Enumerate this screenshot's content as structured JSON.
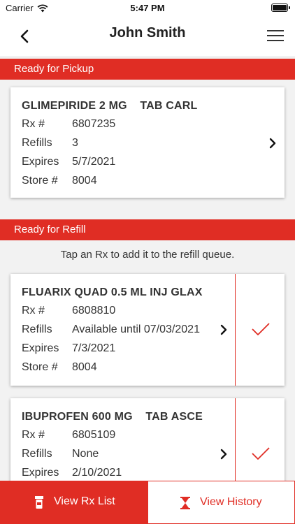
{
  "status_bar": {
    "carrier": "Carrier",
    "time": "5:47 PM"
  },
  "nav": {
    "title": "John Smith",
    "back_icon": "chevron-left-icon",
    "menu_icon": "hamburger-menu-icon"
  },
  "pickup": {
    "header": "Ready for Pickup",
    "card": {
      "drug": "GLIMEPIRIDE 2 MG    TAB CARL",
      "rows": [
        {
          "label": "Rx #",
          "value": "6807235"
        },
        {
          "label": "Refills",
          "value": "3"
        },
        {
          "label": "Expires",
          "value": "5/7/2021"
        },
        {
          "label": "Store #",
          "value": "8004"
        }
      ]
    }
  },
  "refill": {
    "header": "Ready for Refill",
    "instruction": "Tap an Rx to add it to the refill queue.",
    "cards": [
      {
        "drug": "FLUARIX QUAD 0.5 ML INJ GLAX",
        "rows": [
          {
            "label": "Rx #",
            "value": "6808810"
          },
          {
            "label": "Refills",
            "value": "Available until 07/03/2021"
          },
          {
            "label": "Expires",
            "value": "7/3/2021"
          },
          {
            "label": "Store #",
            "value": "8004"
          }
        ]
      },
      {
        "drug": "IBUPROFEN 600 MG    TAB ASCE",
        "rows": [
          {
            "label": "Rx #",
            "value": "6805109"
          },
          {
            "label": "Refills",
            "value": "None"
          },
          {
            "label": "Expires",
            "value": "2/10/2021"
          }
        ]
      }
    ]
  },
  "bottom": {
    "view_rx_list": "View Rx List",
    "view_history": "View History"
  },
  "colors": {
    "accent": "#e02d24",
    "background": "#f2f2f2"
  }
}
